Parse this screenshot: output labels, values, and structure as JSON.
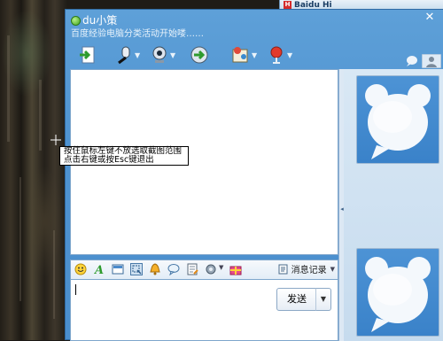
{
  "background_window": {
    "title": "Baidu Hi"
  },
  "chat": {
    "contact_name": "du小策",
    "signature": "百度经验电脑分类活动开始喽……",
    "toolbar_icons": [
      "send-file-icon",
      "voice-icon",
      "video-icon",
      "remote-assist-icon",
      "app-share-icon",
      "more-apps-icon"
    ],
    "side_tab_icons": [
      "chat-bubble-icon",
      "profile-icon"
    ],
    "input_toolbar_icons": [
      "emoticon-icon",
      "font-icon",
      "image-icon",
      "screenshot-icon",
      "shake-icon",
      "bubble-icon",
      "note-icon",
      "settings-icon",
      "gift-icon"
    ],
    "history_label": "消息记录",
    "send_label": "发送"
  },
  "capture_tip": {
    "line1": "按住鼠标左键不放选取截图范围",
    "line2": "点击右键或按Esc键退出"
  },
  "colors": {
    "window_blue": "#4f93d1",
    "panel_light": "#d9e8f5",
    "status_online": "#3fa51c",
    "avatar_blue": "#3a82c9"
  }
}
